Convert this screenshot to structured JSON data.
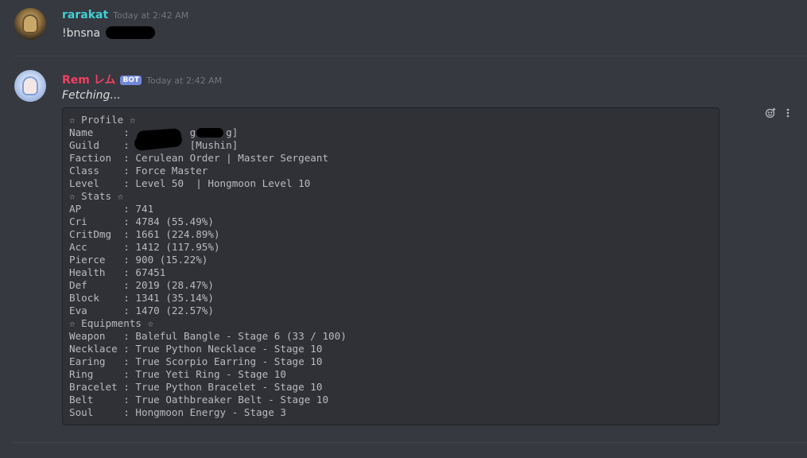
{
  "messages": [
    {
      "username": "rarakat",
      "timestamp": "Today at 2:42 AM",
      "content": "!bnsna"
    },
    {
      "username": "Rem レム",
      "badge": "BOT",
      "timestamp": "Today at 2:42 AM",
      "content": "Fetching...",
      "code_lines": [
        "☆ Profile ☆",
        "Name     :          g [   g]",
        "Guild    :          [Mushin]",
        "Faction  : Cerulean Order | Master Sergeant",
        "Class    : Force Master",
        "Level    : Level 50  | Hongmoon Level 10",
        "☆ Stats ☆",
        "AP       : 741",
        "Cri      : 4784 (55.49%)",
        "CritDmg  : 1661 (224.89%)",
        "Acc      : 1412 (117.95%)",
        "Pierce   : 900 (15.22%)",
        "Health   : 67451",
        "Def      : 2019 (28.47%)",
        "Block    : 1341 (35.14%)",
        "Eva      : 1470 (22.57%)",
        "☆ Equipments ☆",
        "Weapon   : Baleful Bangle - Stage 6 (33 / 100)",
        "Necklace : True Python Necklace - Stage 10",
        "Earing   : True Scorpio Earring - Stage 10",
        "Ring     : True Yeti Ring - Stage 10",
        "Bracelet : True Python Bracelet - Stage 10",
        "Belt     : True Oathbreaker Belt - Stage 10",
        "Soul     : Hongmoon Energy - Stage 3"
      ]
    }
  ],
  "actions": {
    "reaction_icon": "add-reaction-icon",
    "more_icon": "more-options-icon"
  },
  "colors": {
    "background": "#36393f",
    "user1": "#3fd1d6",
    "user2": "#f04060",
    "bot_badge": "#7289da",
    "codeblock_bg": "#2f3136"
  }
}
